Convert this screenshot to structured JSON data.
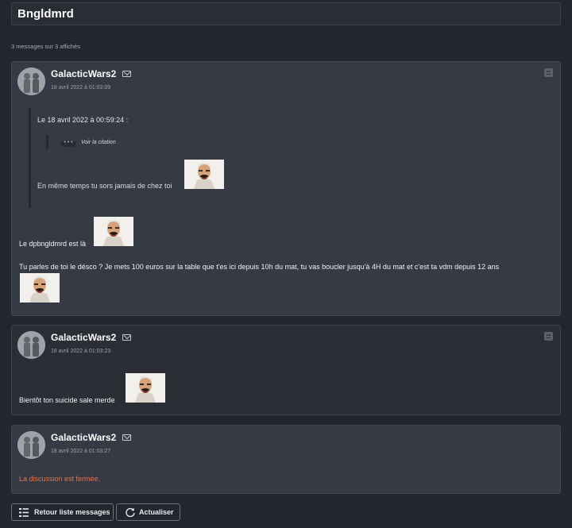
{
  "topic": {
    "title": "Bngldmrd"
  },
  "message_count": "3 messages sur 3 affichés",
  "messages": [
    {
      "author": "GalacticWars2",
      "date": "18 avril 2022 à 01:03:09",
      "quote": {
        "header": "Le 18 avril 2022 à 00:59:24 :",
        "see_quote": "Voir la citation",
        "text": "En même temps tu sors jamais de chez toi"
      },
      "line1": "Le dpbngldmrd est là",
      "line2": "Tu parles de toi le désco ? Je mets 100 euros sur la table que t'es ici depuis 10h du mat, tu vas boucler jusqu'à 4H du mat et c'est ta vdm depuis 12 ans"
    },
    {
      "author": "GalacticWars2",
      "date": "18 avril 2022 à 01:03:23",
      "text": "Bientôt ton suicide sale merde"
    },
    {
      "author": "GalacticWars2",
      "date": "18 avril 2022 à 01:03:27",
      "text": "La discussion est fermée."
    }
  ],
  "buttons": {
    "back": "Retour liste messages",
    "refresh": "Actualiser"
  },
  "colors": {
    "background": "#23262d",
    "post_bg": "#353a45",
    "closed_text": "#e8704a"
  },
  "icons": [
    "mail-icon",
    "report-icon",
    "list-icon",
    "refresh-icon"
  ]
}
